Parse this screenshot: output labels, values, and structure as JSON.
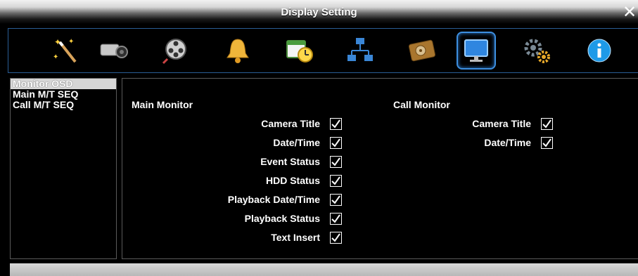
{
  "window": {
    "title": "Display Setting",
    "close_symbol": "✕"
  },
  "toolbar": {
    "icons": [
      {
        "name": "wizard-wand-icon"
      },
      {
        "name": "camera-icon"
      },
      {
        "name": "film-reel-icon"
      },
      {
        "name": "alarm-bell-icon"
      },
      {
        "name": "schedule-clock-icon"
      },
      {
        "name": "network-icon"
      },
      {
        "name": "hdd-icon"
      },
      {
        "name": "display-monitor-icon",
        "active": true
      },
      {
        "name": "system-gears-icon"
      },
      {
        "name": "info-icon"
      }
    ]
  },
  "sidebar": {
    "items": [
      {
        "label": "Monitor OSD",
        "selected": true
      },
      {
        "label": "Main M/T SEQ",
        "selected": false
      },
      {
        "label": "Call M/T SEQ",
        "selected": false
      }
    ]
  },
  "main_monitor": {
    "heading": "Main Monitor",
    "options": [
      {
        "label": "Camera Title",
        "checked": true
      },
      {
        "label": "Date/Time",
        "checked": true
      },
      {
        "label": "Event Status",
        "checked": true
      },
      {
        "label": "HDD Status",
        "checked": true
      },
      {
        "label": "Playback Date/Time",
        "checked": true
      },
      {
        "label": "Playback Status",
        "checked": true
      },
      {
        "label": "Text Insert",
        "checked": true
      }
    ]
  },
  "call_monitor": {
    "heading": "Call Monitor",
    "options": [
      {
        "label": "Camera Title",
        "checked": true
      },
      {
        "label": "Date/Time",
        "checked": true
      }
    ]
  },
  "colors": {
    "accent": "#3d8fe0",
    "border": "#2a5e95",
    "background": "#000000"
  }
}
